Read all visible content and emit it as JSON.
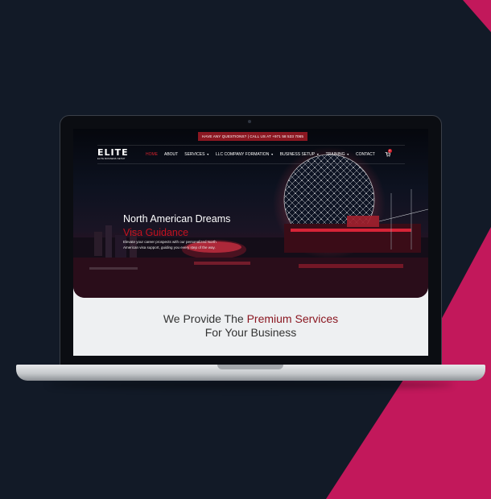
{
  "colors": {
    "background": "#121a27",
    "accent_pink": "#c2185b",
    "brand_red": "#8b1721"
  },
  "topbar": {
    "text": "HAVE ANY QUESTIONS? | CALL US AT +971 58 533 7065"
  },
  "logo": {
    "word": "ELITE",
    "tagline": "ELITE BUSINESS SETUP"
  },
  "nav": {
    "items": [
      {
        "label": "HOME",
        "active": true,
        "dropdown": false
      },
      {
        "label": "ABOUT",
        "active": false,
        "dropdown": false
      },
      {
        "label": "SERVICES",
        "active": false,
        "dropdown": true
      },
      {
        "label": "LLC COMPANY FORMATION",
        "active": false,
        "dropdown": true
      },
      {
        "label": "BUSINESS SETUP",
        "active": false,
        "dropdown": true
      },
      {
        "label": "TRAINING",
        "active": false,
        "dropdown": true
      },
      {
        "label": "CONTACT",
        "active": false,
        "dropdown": false
      }
    ],
    "cart_icon": "cart-icon",
    "cart_count": "0"
  },
  "hero": {
    "title": "North American Dreams",
    "subtitle": "Visa Guidance",
    "description": "Elevate your career prospects with our personalized North American visa support, guiding you every step of the way."
  },
  "services": {
    "heading_prefix": "We Provide The ",
    "heading_highlight": "Premium Services",
    "heading_suffix": "For Your Business"
  }
}
